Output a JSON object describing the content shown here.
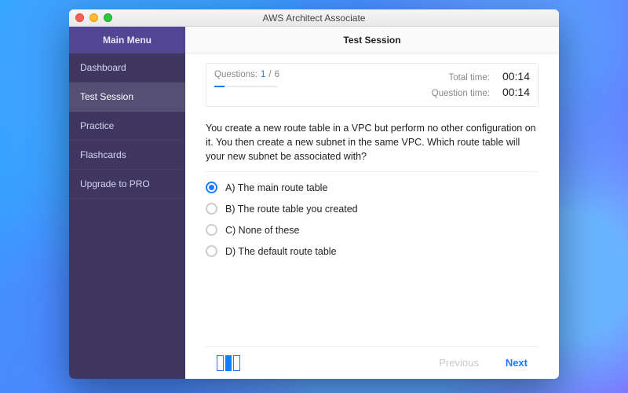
{
  "window": {
    "title": "AWS Architect Associate"
  },
  "sidebar": {
    "heading": "Main Menu",
    "items": [
      "Dashboard",
      "Test Session",
      "Practice",
      "Flashcards",
      "Upgrade to PRO"
    ],
    "active_index": 1
  },
  "content": {
    "heading": "Test Session",
    "progress": {
      "label": "Questions:",
      "current": "1",
      "sep": "/",
      "total": "6",
      "percent": 16.67
    },
    "times": {
      "total_label": "Total time:",
      "total_value": "00:14",
      "question_label": "Question time:",
      "question_value": "00:14"
    },
    "question": "You create a new route table in a VPC but perform no other configuration on it. You then create a new subnet in the same VPC. Which route table will your new subnet be associated with?",
    "answers": [
      {
        "label": "A) The main route table",
        "selected": true
      },
      {
        "label": "B) The route table you created",
        "selected": false
      },
      {
        "label": "C) None of these",
        "selected": false
      },
      {
        "label": "D) The default route table",
        "selected": false
      }
    ],
    "nav": {
      "previous": "Previous",
      "next": "Next"
    }
  }
}
